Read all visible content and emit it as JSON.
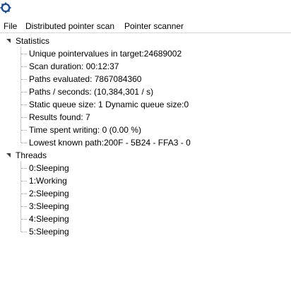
{
  "menu": {
    "items": [
      "File",
      "Distributed pointer scan",
      "Pointer scanner"
    ]
  },
  "tree": {
    "statistics": {
      "label": "Statistics",
      "expanded": true,
      "children": [
        "Unique pointervalues in target:24689002",
        "Scan duration: 00:12:37",
        "Paths evaluated: 7867084360",
        "Paths / seconds: (10,384,301 / s)",
        "Static queue size: 1 Dynamic queue size:0",
        "Results found: 7",
        "Time spent writing: 0 (0.00 %)",
        "Lowest known path:200F - 5B24 - FFA3 - 0"
      ]
    },
    "threads": {
      "label": "Threads",
      "expanded": true,
      "children": [
        "0:Sleeping",
        "1:Working",
        "2:Sleeping",
        "3:Sleeping",
        "4:Sleeping",
        "5:Sleeping"
      ]
    }
  },
  "colors": {
    "icon_blue": "#1a4f9c",
    "tree_lines": "#a0a0a0"
  },
  "icons": {
    "app": "cheat-engine-icon",
    "expander": "expanded-triangle-icon"
  }
}
